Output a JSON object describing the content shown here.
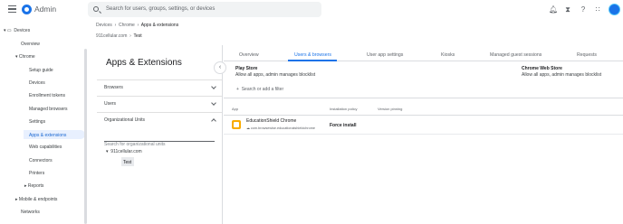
{
  "app": {
    "title": "Admin"
  },
  "search": {
    "placeholder": "Search for users, groups, settings, or devices"
  },
  "sidebar": {
    "items": [
      {
        "label": "Devices"
      },
      {
        "label": "Overview"
      },
      {
        "label": "Chrome"
      },
      {
        "label": "Setup guide"
      },
      {
        "label": "Devices"
      },
      {
        "label": "Enrollment tokens"
      },
      {
        "label": "Managed browsers"
      },
      {
        "label": "Settings"
      },
      {
        "label": "Apps & extensions"
      },
      {
        "label": "Web capabilities"
      },
      {
        "label": "Connectors"
      },
      {
        "label": "Printers"
      },
      {
        "label": "Reports"
      },
      {
        "label": "Mobile & endpoints"
      },
      {
        "label": "Networks"
      }
    ]
  },
  "breadcrumb": {
    "items": [
      "Devices",
      "Chrome",
      "Apps & extensions"
    ]
  },
  "ou_breadcrumb": {
    "items": [
      "911cellular.com",
      "Test"
    ]
  },
  "panel": {
    "title": "Apps & Extensions",
    "sections": [
      "Browsers",
      "Users",
      "Organizational Units"
    ],
    "ou_search_placeholder": "Search for organizational units",
    "tree_root": "911cellular.com",
    "tree_child": "Test"
  },
  "tabs": [
    "Overview",
    "Users & browsers",
    "User app settings",
    "Kiosks",
    "Managed guest sessions",
    "Requests"
  ],
  "stores": {
    "play_title": "Play Store",
    "play_sub": "Allow all apps, admin manages blocklist",
    "web_title": "Chrome Web Store",
    "web_sub": "Allow all apps, admin manages blocklist"
  },
  "filter": {
    "label": "Search or add a filter"
  },
  "table": {
    "headers": [
      "App",
      "Installation policy",
      "Version pinning"
    ],
    "rows": [
      {
        "name": "EducationShield Chrome",
        "id": "com.browsewise.educationalshieldchrome",
        "policy": "Force install"
      }
    ]
  },
  "colors": {
    "accent": "#1a73e8",
    "active_bg": "#e8f0fe"
  },
  "icons": [
    "menu-icon",
    "search-icon",
    "bell-icon",
    "hourglass-icon",
    "help-icon",
    "apps-icon"
  ]
}
